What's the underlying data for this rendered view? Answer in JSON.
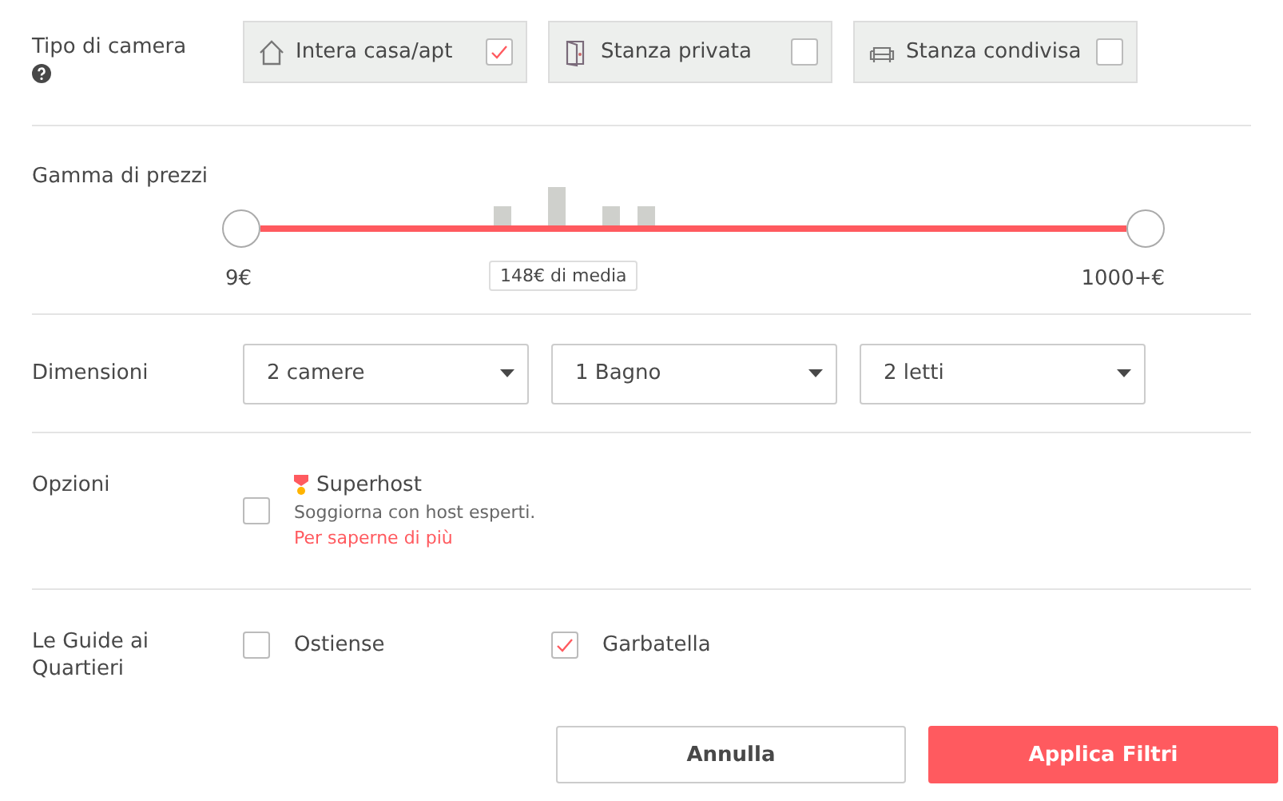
{
  "room_type": {
    "label": "Tipo di camera",
    "options": [
      {
        "kind": "house",
        "label": "Intera casa/apt",
        "checked": true
      },
      {
        "kind": "door",
        "label": "Stanza privata",
        "checked": false
      },
      {
        "kind": "sofa",
        "label": "Stanza condivisa",
        "checked": false
      }
    ]
  },
  "price_range": {
    "label": "Gamma di prezzi",
    "thumbs": [
      {
        "level": 0
      },
      {
        "level": 1
      }
    ],
    "min_label": "9€",
    "max_label": "1000+€",
    "average": "148€ di media"
  },
  "size": {
    "label": "Dimensioni",
    "dropdowns": [
      "2 camere",
      "1 Bagno",
      "2 letti"
    ]
  },
  "options": {
    "label": "Opzioni",
    "items": [
      {
        "title": "Superhost",
        "description": "Soggiorna con host esperti.",
        "link": "Per saperne di più",
        "checked": false
      }
    ]
  },
  "neighborhoods": {
    "label": "Le Guide ai Quartieri",
    "items": [
      {
        "label": "Ostiense",
        "checked": false
      },
      {
        "label": "Garbatella",
        "checked": true
      }
    ]
  },
  "buttons": [
    {
      "kind": "secondary",
      "label": "Annulla"
    },
    {
      "kind": "primary",
      "label": "Applica Filtri"
    }
  ]
}
